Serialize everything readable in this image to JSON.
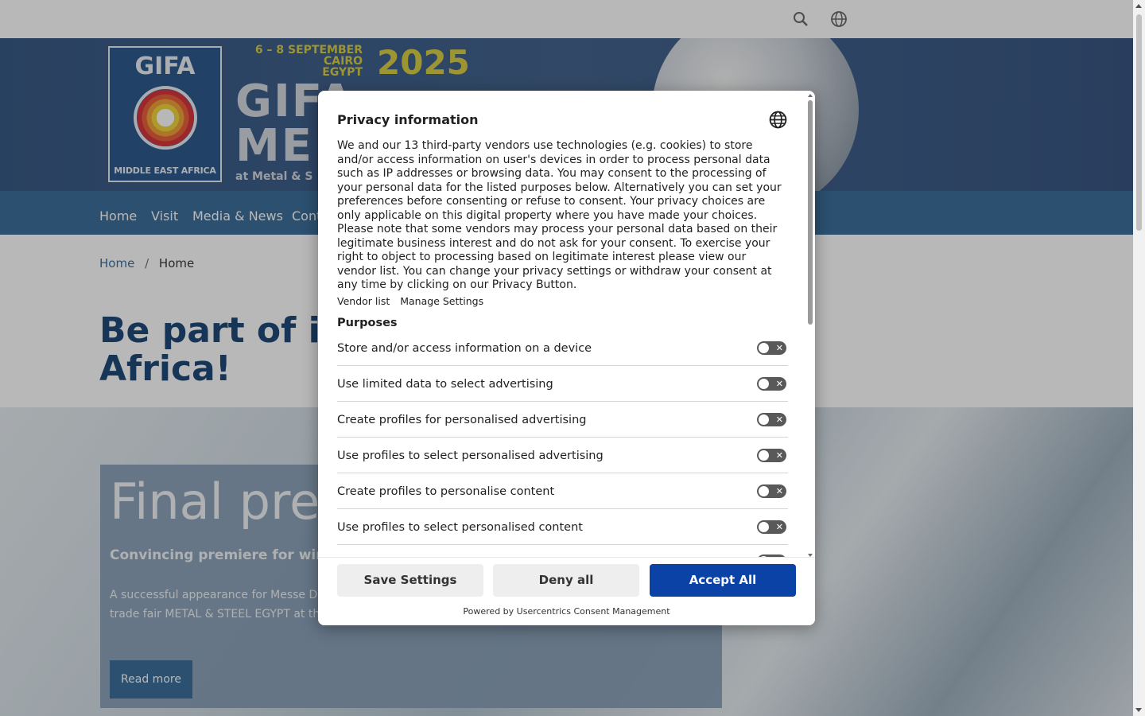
{
  "hero": {
    "logo_top": "GIFA",
    "logo_bottom": "MIDDLE EAST AFRICA",
    "dates_line1": "6 – 8 SEPTEMBER",
    "dates_line2": "CAIRO",
    "dates_line3": "EGYPT",
    "year": "2025",
    "big_line1": "GIFA",
    "big_line2": "ME",
    "sub": "at Metal & S"
  },
  "nav": {
    "items": [
      "Home",
      "Visit",
      "Media & News",
      "Cont"
    ]
  },
  "breadcrumb": {
    "items": [
      "Home",
      "Home"
    ],
    "separator": "/"
  },
  "headline": {
    "line1": "Be part of it -",
    "line2": "Africa!"
  },
  "card": {
    "title": "Final pre",
    "subtitle": "Convincing premiere for wire a",
    "text": "A successful appearance for Messe Düss... and Tube Middle East Africa, together w... time at the Egyptian trade fair METAL & STEEL EGYPT at the Egypt International Exhibition Center in Cairo/Egypt.",
    "button": "Read more"
  },
  "consent": {
    "title": "Privacy information",
    "description": "We and our 13 third-party vendors use technologies (e.g. cookies) to store and/or access information on user's devices in order to process personal data such as IP addresses or browsing data. You may consent to the processing of your personal data for the listed purposes below. Alternatively you can set your preferences before consenting or refuse to consent. Your privacy choices are only applicable on this digital property where you have made your choices. Please note that some vendors may process your personal data based on their legitimate business interest and do not ask for your consent. To exercise your right to object to processing based on legitimate interest please view our vendor list. You can change your privacy settings or withdraw your consent at any time by clicking on our Privacy Button.",
    "links": [
      "Vendor list",
      "Manage Settings"
    ],
    "purposes_heading": "Purposes",
    "purposes": [
      "Store and/or access information on a device",
      "Use limited data to select advertising",
      "Create profiles for personalised advertising",
      "Use profiles to select personalised advertising",
      "Create profiles to personalise content",
      "Use profiles to select personalised content"
    ],
    "toggle_state": "off",
    "buttons": {
      "save": "Save Settings",
      "deny": "Deny all",
      "accept": "Accept All"
    },
    "powered_by": "Powered by Usercentrics Consent Management"
  },
  "icons": [
    "search-icon",
    "globe-icon",
    "language-globe-icon",
    "close-x-icon"
  ],
  "colors": {
    "accent": "#0a43a5",
    "nav": "#3d6f9c",
    "hero": "#3a5a86",
    "headline": "#214c79"
  }
}
